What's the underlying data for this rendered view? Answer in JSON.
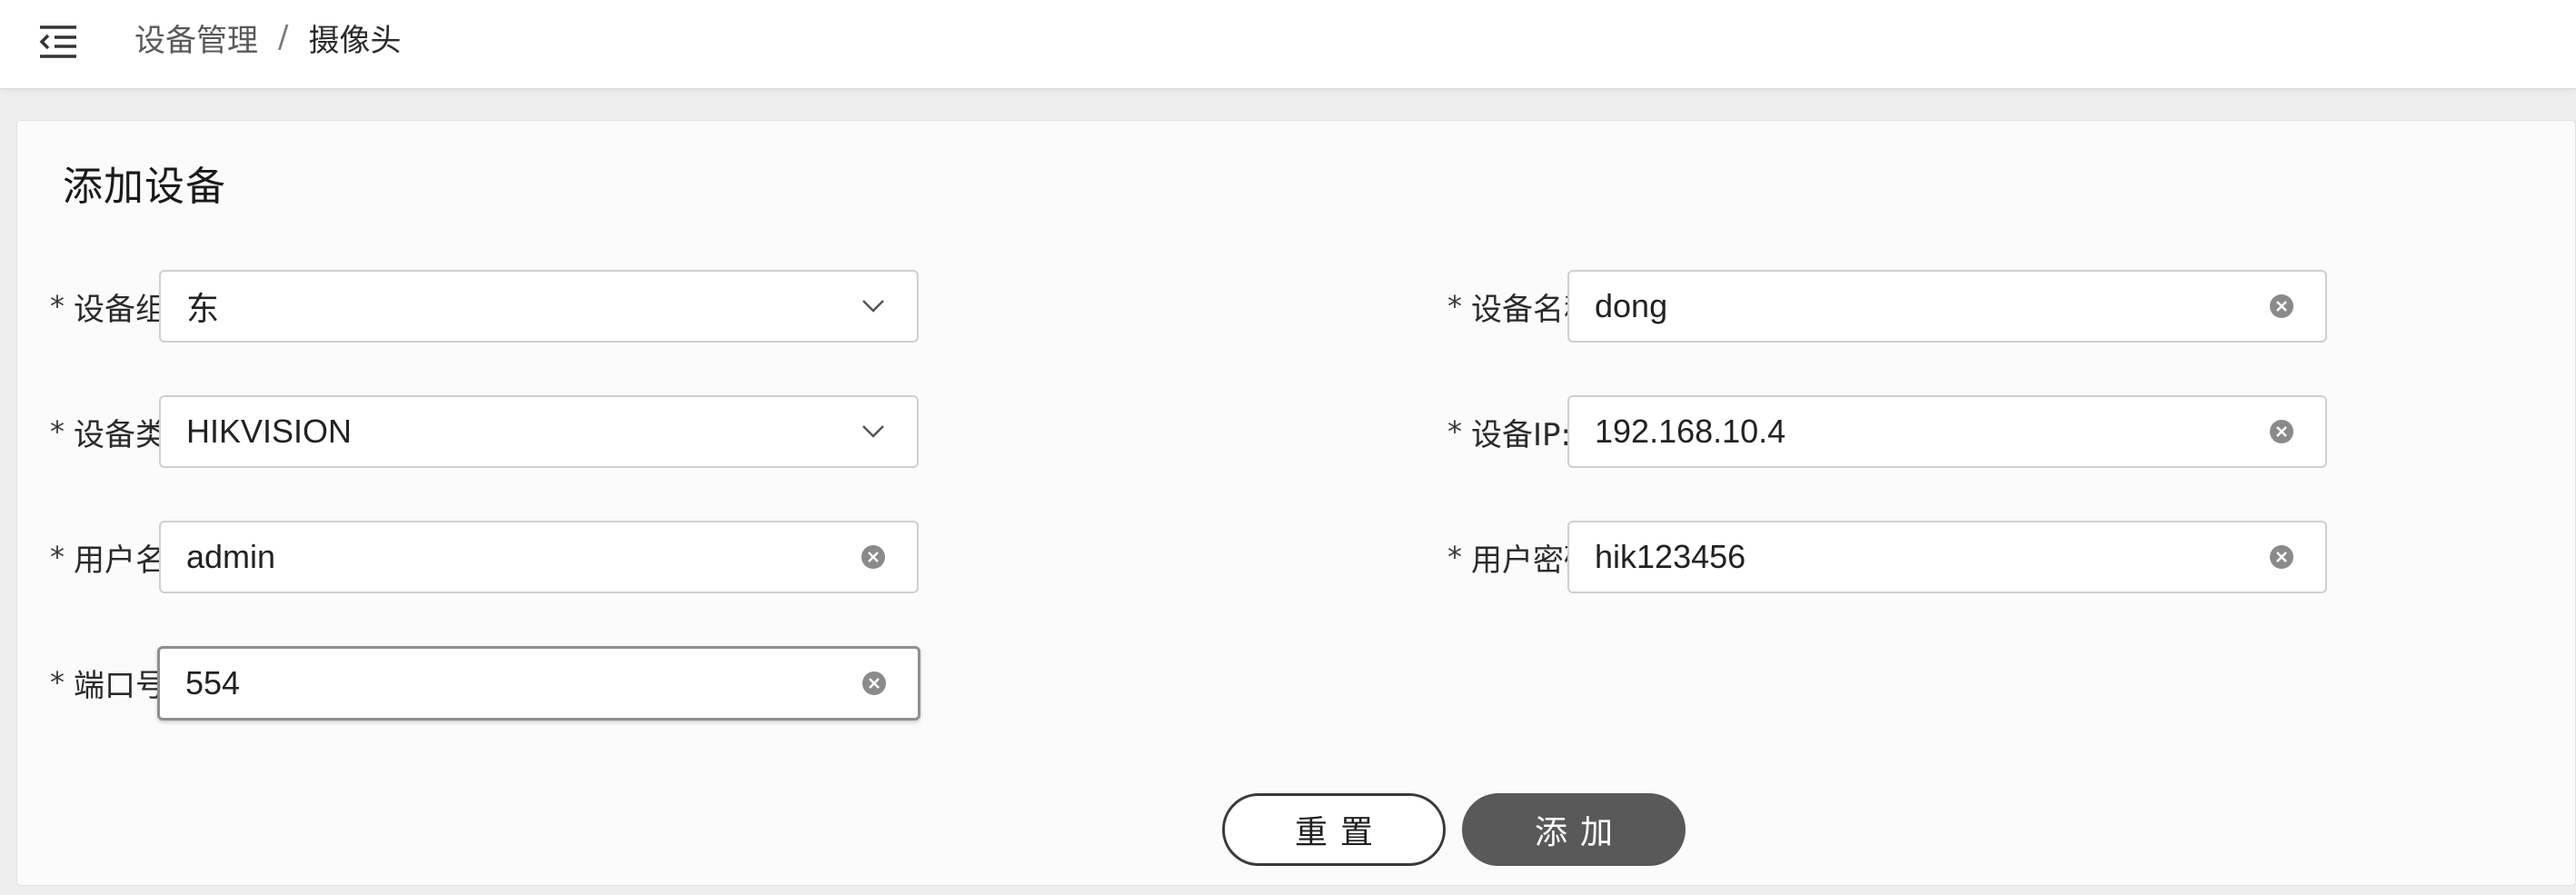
{
  "breadcrumb": {
    "parent": "设备管理",
    "separator": "/",
    "current": "摄像头"
  },
  "form": {
    "title": "添加设备",
    "required_mark": "*",
    "fields": {
      "device_group": {
        "label": "设备组:",
        "value": "东"
      },
      "device_name": {
        "label": "设备名称:",
        "value": "dong"
      },
      "device_type": {
        "label": "设备类型:",
        "value": "HIKVISION"
      },
      "device_ip": {
        "label": "设备IP:",
        "value": "192.168.10.4"
      },
      "username": {
        "label": "用户名:",
        "value": "admin"
      },
      "password": {
        "label": "用户密码:",
        "value": "hik123456"
      },
      "port": {
        "label": "端口号:",
        "value": "554"
      }
    }
  },
  "buttons": {
    "reset_label": "重置",
    "add_label": "添加"
  },
  "icons": {
    "menu": "menu-fold-icon",
    "dropdown": "chevron-down-icon",
    "clear": "clear-circle-icon"
  }
}
